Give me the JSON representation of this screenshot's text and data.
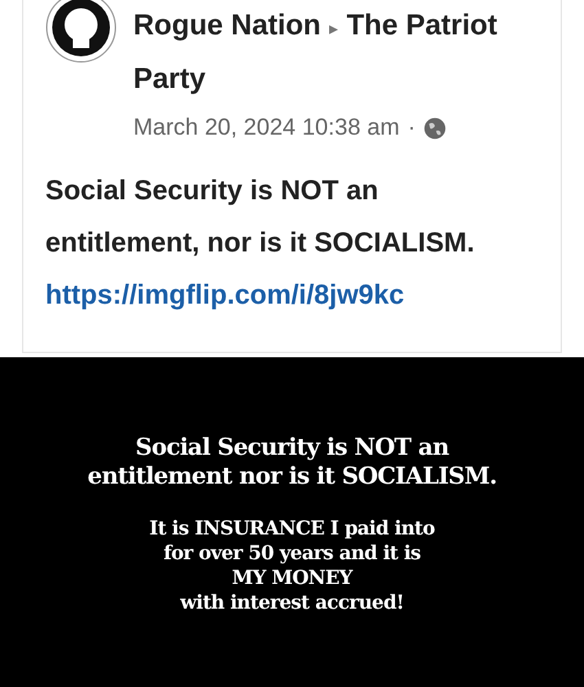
{
  "post": {
    "author": "Rogue Nation",
    "separator": "▸",
    "group": "The Patriot Party",
    "timestamp": "March 20, 2024 10:38 am",
    "dot": "·",
    "text_lines": [
      "Social Security is NOT an",
      "entitlement, nor is it SOCIALISM."
    ],
    "link": "https://imgflip.com/i/8jw9kc"
  },
  "image": {
    "headline_lines": [
      "Social Security is NOT an",
      "entitlement nor is it SOCIALISM."
    ],
    "body_lines": [
      "It is INSURANCE I paid into",
      "for over 50 years and it is",
      "MY MONEY",
      "with interest accrued!"
    ]
  }
}
